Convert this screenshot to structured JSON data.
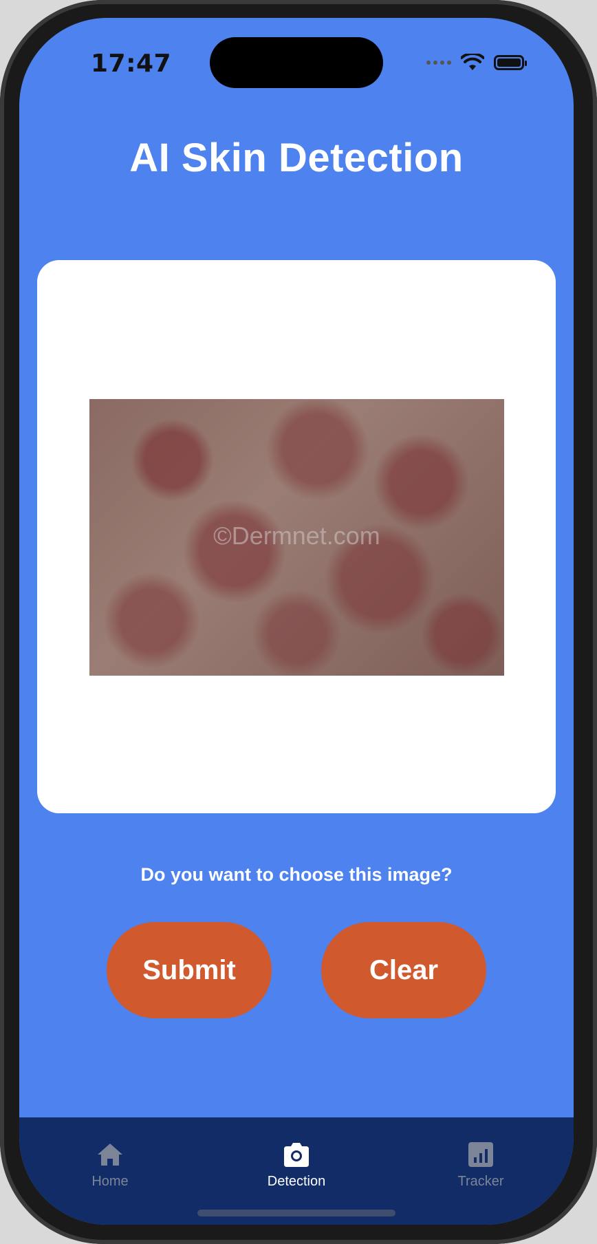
{
  "status_bar": {
    "time": "17:47"
  },
  "header": {
    "title": "AI Skin Detection"
  },
  "preview": {
    "watermark": "©Dermnet.com"
  },
  "prompt": {
    "question": "Do you want to choose this image?"
  },
  "actions": {
    "submit_label": "Submit",
    "clear_label": "Clear"
  },
  "tab_bar": {
    "items": [
      {
        "label": "Home",
        "icon": "home-icon",
        "active": false
      },
      {
        "label": "Detection",
        "icon": "camera-icon",
        "active": true
      },
      {
        "label": "Tracker",
        "icon": "chart-icon",
        "active": false
      }
    ]
  },
  "colors": {
    "background": "#4e82ee",
    "button": "#d05a2d",
    "tab_bar": "#122c68",
    "tab_active": "#ffffff",
    "tab_inactive": "#7c8598"
  }
}
